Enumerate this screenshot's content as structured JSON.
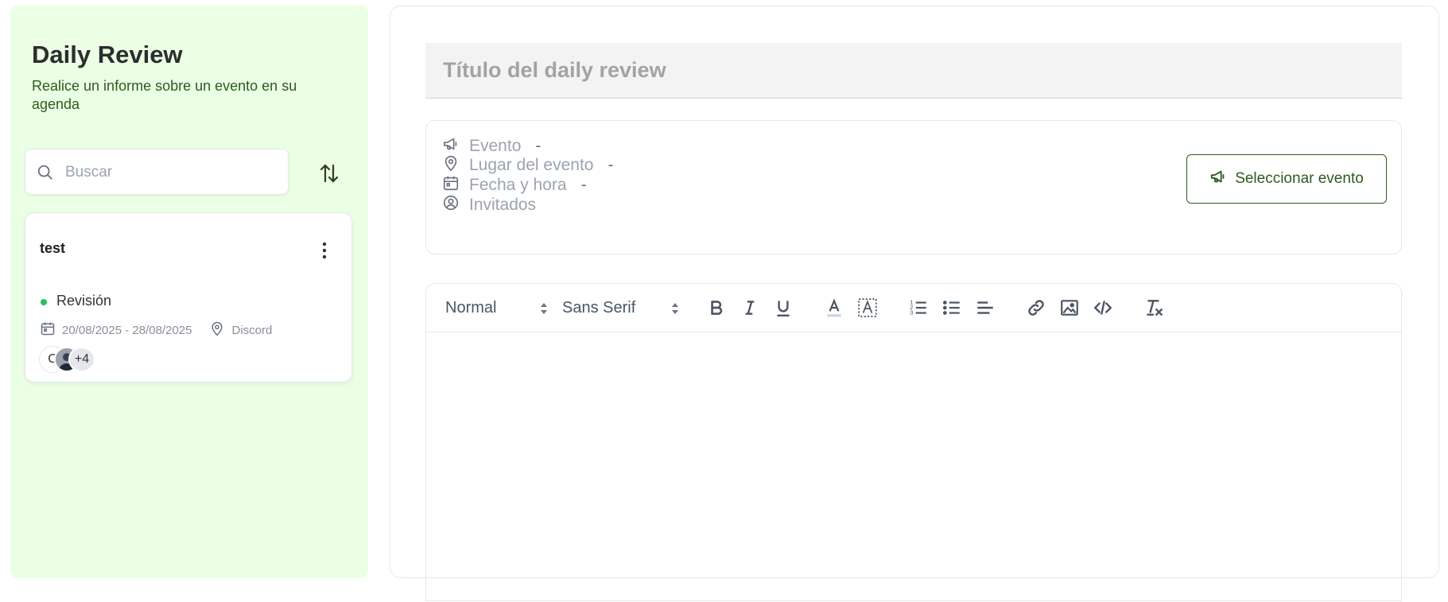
{
  "sidebar": {
    "title": "Daily Review",
    "subtitle": "Realice un informe sobre un evento en su agenda",
    "search_placeholder": "Buscar",
    "card": {
      "title": "test",
      "status": "Revisión",
      "status_color": "#22c55e",
      "dates": "20/08/2025 - 28/08/2025",
      "location": "Discord",
      "avatar_initial": "C",
      "avatar_more": "+4"
    }
  },
  "main": {
    "title_placeholder": "Título del daily review",
    "event": {
      "event_label": "Evento",
      "event_value": "-",
      "place_label": "Lugar del evento",
      "place_value": "-",
      "datetime_label": "Fecha y hora",
      "datetime_value": "-",
      "guests_label": "Invitados"
    },
    "select_event_label": "Seleccionar evento",
    "editor": {
      "size_value": "Normal",
      "font_value": "Sans Serif"
    }
  },
  "colors": {
    "sidebar_bg": "#eaffe4",
    "accent": "#2f5a1e"
  }
}
